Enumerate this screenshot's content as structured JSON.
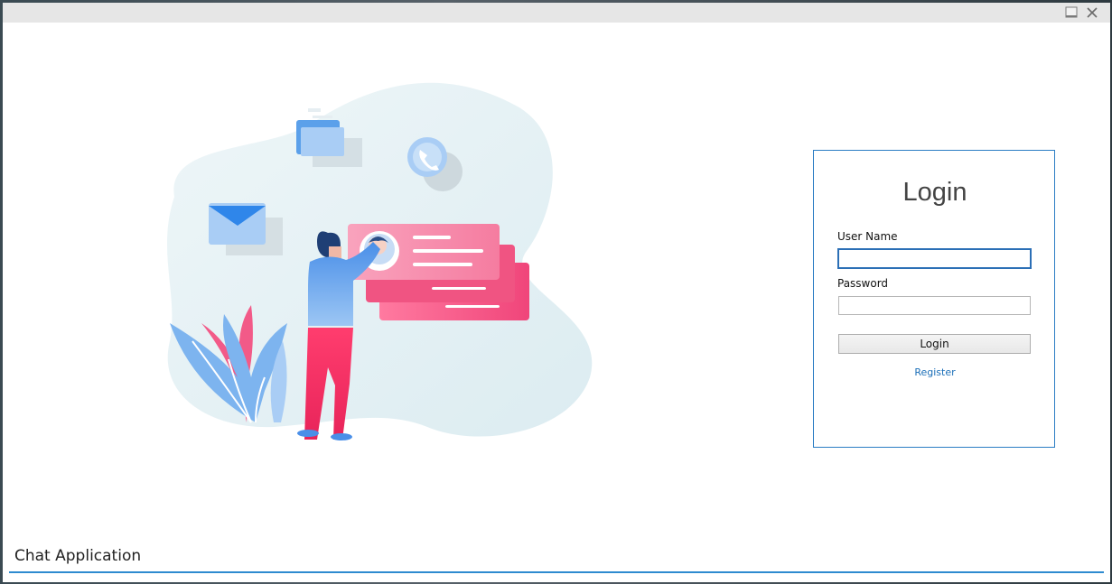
{
  "window": {
    "minimize_icon": "minimize-icon",
    "close_icon": "close-icon"
  },
  "illustration": {
    "icons": [
      "folder-icon",
      "phone-icon",
      "mail-icon",
      "chat-card-icon"
    ],
    "colors": {
      "blob": "#e4f1f5",
      "pink": "#f0457a",
      "blue": "#4a8fe8"
    }
  },
  "login": {
    "title": "Login",
    "username_label": "User Name",
    "username_value": "",
    "password_label": "Password",
    "password_value": "",
    "login_button": "Login",
    "register_link": "Register",
    "accent": "#2b7dc4"
  },
  "footer": {
    "app_title": "Chat Application",
    "accent": "#2e8bd0"
  }
}
